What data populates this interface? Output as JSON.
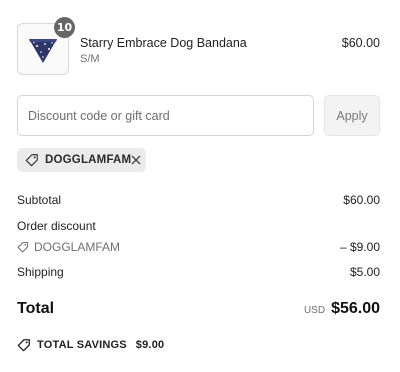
{
  "product": {
    "quantity": "10",
    "name": "Starry Embrace Dog Bandana",
    "variant": "S/M",
    "price": "$60.00",
    "thumbnail_icon": "bandana-image"
  },
  "discount": {
    "placeholder": "Discount code or gift card",
    "apply_label": "Apply",
    "applied_code": "DOGGLAMFAM"
  },
  "summary": {
    "subtotal_label": "Subtotal",
    "subtotal_value": "$60.00",
    "order_discount_label": "Order discount",
    "discount_code": "DOGGLAMFAM",
    "discount_value": "– $9.00",
    "shipping_label": "Shipping",
    "shipping_value": "$5.00",
    "total_label": "Total",
    "currency": "USD",
    "total_value": "$56.00",
    "savings_label": "TOTAL SAVINGS",
    "savings_value": "$9.00"
  },
  "colors": {
    "badge": "#666666",
    "tag_background": "#ebebeb",
    "apply_background": "#f3f3f3"
  }
}
